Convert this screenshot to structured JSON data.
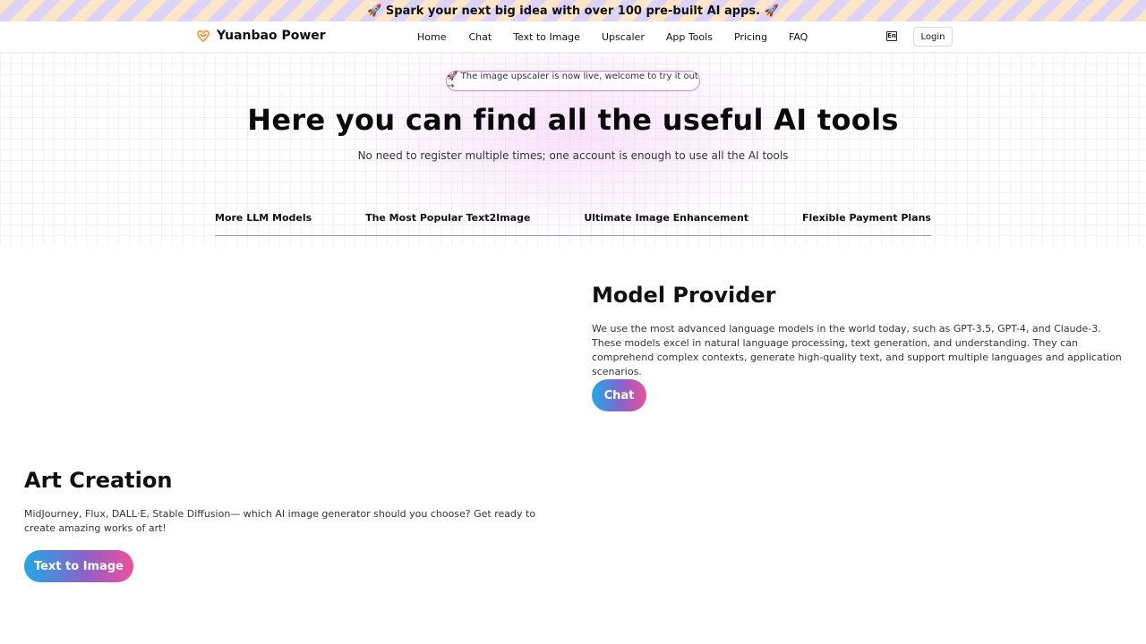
{
  "promo": {
    "text": "🚀 Spark your next big idea with over 100 pre-built AI apps. 🚀"
  },
  "nav": {
    "brand": "Yuanbao Power",
    "links": [
      "Home",
      "Chat",
      "Text to Image",
      "Upscaler",
      "App Tools",
      "Pricing",
      "FAQ"
    ],
    "lang_icon": "En",
    "login": "Login"
  },
  "hero": {
    "announcement": "🚀 The image upscaler is now live, welcome to try it out →",
    "title": "Here you can find all the useful AI tools",
    "subtitle": "No need to register multiple times; one account is enough to use all the AI tools",
    "features": [
      "More LLM Models",
      "The Most Popular Text2Image",
      "Ultimate Image Enhancement",
      "Flexible Payment Plans"
    ]
  },
  "model_section": {
    "title": "Model Provider",
    "description": "We use the most advanced language models in the world today, such as GPT-3.5, GPT-4, and Claude-3. These models excel in natural language processing, text generation, and understanding. They can comprehend complex contexts, generate high-quality text, and support multiple languages and application scenarios.",
    "button": "Chat"
  },
  "art_section": {
    "title": "Art Creation",
    "description": "MidJourney, Flux, DALL·E, Stable Diffusion— which AI image generator should you choose? Get ready to create amazing works of art!",
    "button": "Text to Image"
  },
  "colors": {
    "gradient_start": "#22a7e8",
    "gradient_end": "#ef4f9a",
    "pill_border": "#c98ec9",
    "logo_accent": "#f4a64a"
  }
}
